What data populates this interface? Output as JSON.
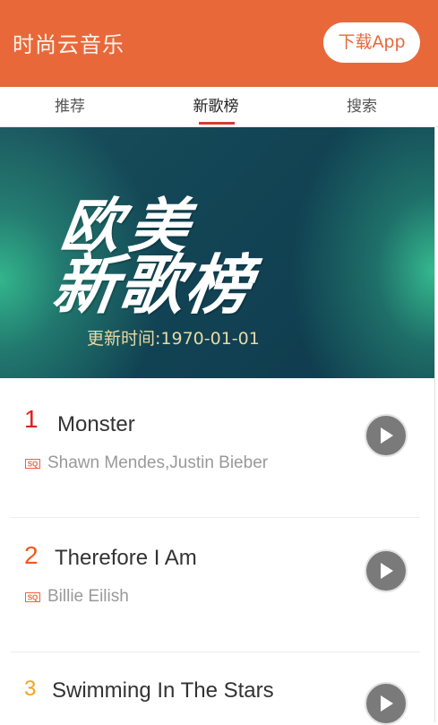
{
  "header": {
    "title": "时尚云音乐",
    "download_label": "下载App",
    "background": "#e8683a"
  },
  "tabs": [
    {
      "label": "推荐",
      "active": false
    },
    {
      "label": "新歌榜",
      "active": true
    },
    {
      "label": "搜索",
      "active": false
    }
  ],
  "banner": {
    "title_line1": "欧美",
    "title_line2": "新歌榜",
    "updated": "更新时间:1970-01-01"
  },
  "songs": [
    {
      "rank": "1",
      "rank_color": "#e21d1d",
      "name": "Monster",
      "artist": "Shawn Mendes,Justin Bieber",
      "badge": "SQ"
    },
    {
      "rank": "2",
      "rank_color": "#f0581e",
      "name": "Therefore I Am",
      "artist": "Billie Eilish",
      "badge": "SQ"
    },
    {
      "rank": "3",
      "rank_color": "#f5a31a",
      "name": "Swimming In The Stars",
      "artist": "",
      "badge": ""
    }
  ],
  "icons": {
    "play": "play-icon",
    "sq": "sq-badge-icon"
  }
}
